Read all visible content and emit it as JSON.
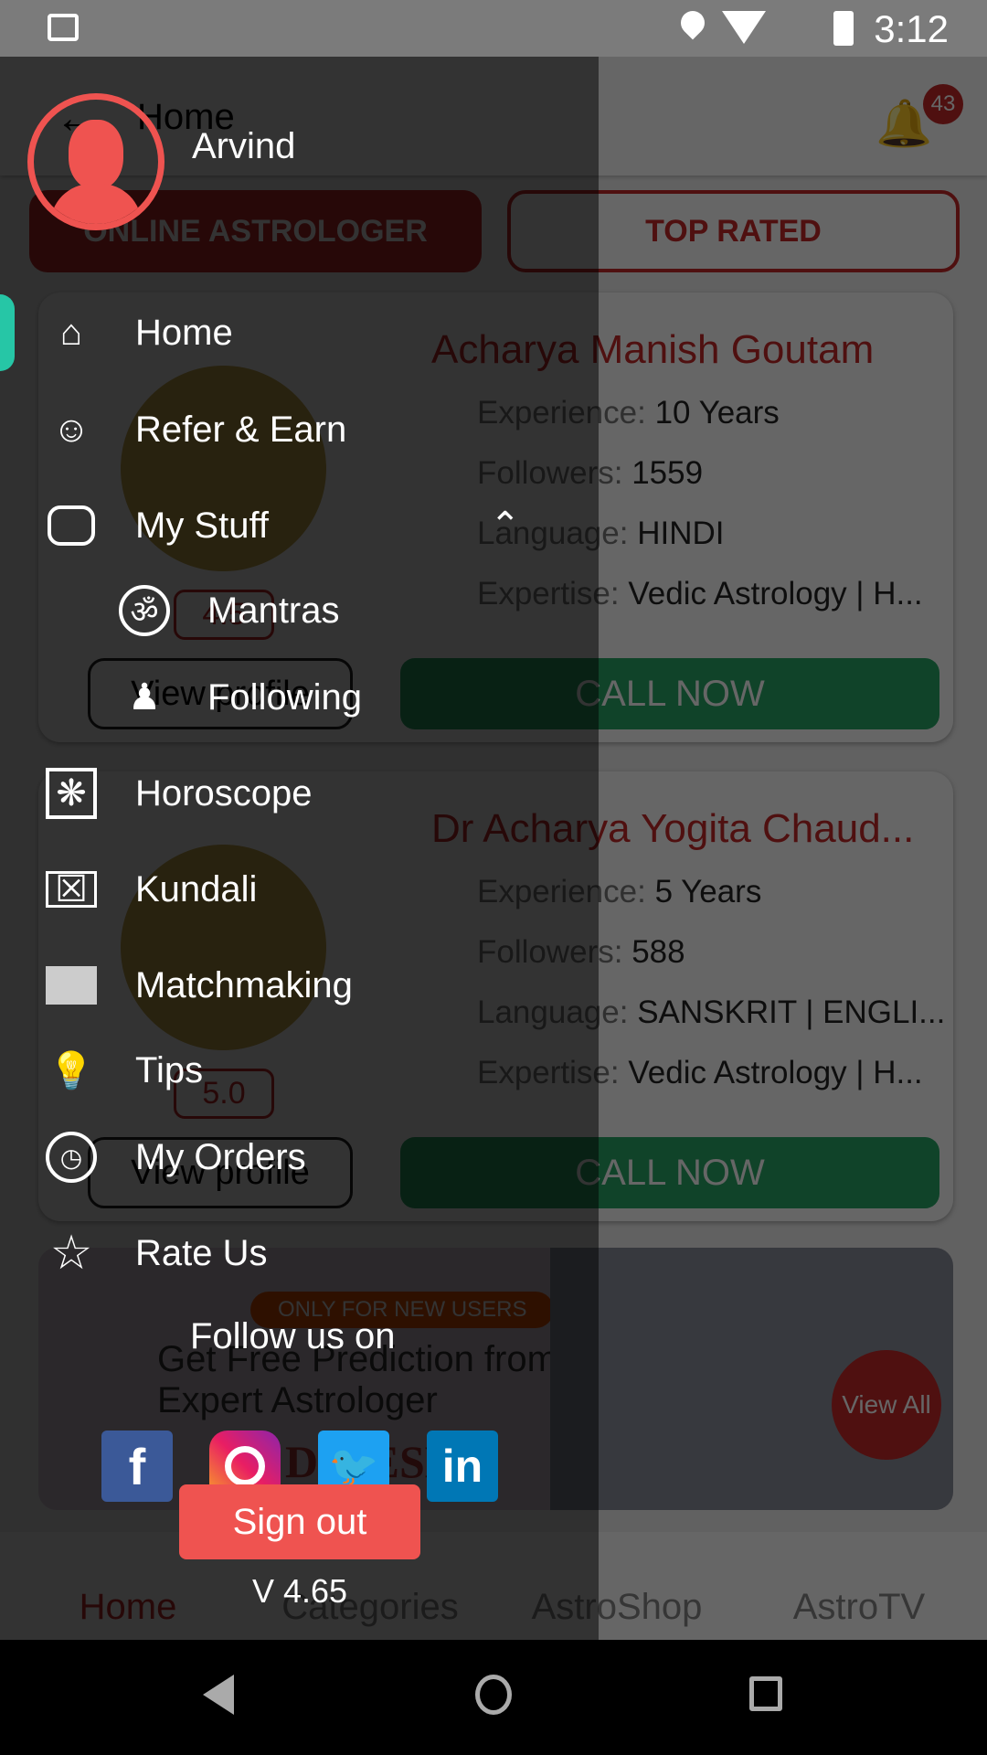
{
  "status_bar": {
    "time": "3:12"
  },
  "app": {
    "header": {
      "title": "Home",
      "notification_count": "43"
    },
    "tabs": [
      "ONLINE ASTROLOGER",
      "TOP RATED"
    ],
    "astrologers": [
      {
        "name": "Acharya Manish Goutam",
        "experience_label": "Experience:",
        "experience": "10 Years",
        "followers_label": "Followers:",
        "followers": "1559",
        "language_label": "Language:",
        "language": "HINDI",
        "expertise_label": "Expertise:",
        "expertise": "Vedic Astrology | H...",
        "rating": "4.5",
        "view_profile": "View profile",
        "call": "CALL NOW"
      },
      {
        "name": "Dr Acharya Yogita Chaud...",
        "experience_label": "Experience:",
        "experience": "5 Years",
        "followers_label": "Followers:",
        "followers": "588",
        "language_label": "Language:",
        "language": "SANSKRIT | ENGLI...",
        "expertise_label": "Expertise:",
        "expertise": "Vedic Astrology | H...",
        "rating": "5.0",
        "view_profile": "View profile",
        "call": "CALL NOW"
      }
    ],
    "banner": {
      "badge": "ONLY FOR NEW USERS",
      "headline": "Get Free Prediction from Our Expert Astrologer",
      "name": "DINESH",
      "view_all": "View All"
    },
    "bottom_nav": [
      "Home",
      "Categories",
      "AstroShop",
      "AstroTV"
    ]
  },
  "drawer": {
    "user_name": "Arvind",
    "items": [
      {
        "label": "Home",
        "icon": "home-icon"
      },
      {
        "label": "Refer & Earn",
        "icon": "refer-icon"
      },
      {
        "label": "My Stuff",
        "icon": "toggle-icon"
      },
      {
        "label": "Mantras",
        "icon": "om-icon"
      },
      {
        "label": "Following",
        "icon": "user-plus-icon"
      },
      {
        "label": "Horoscope",
        "icon": "horoscope-icon"
      },
      {
        "label": "Kundali",
        "icon": "kundali-icon"
      },
      {
        "label": "Matchmaking",
        "icon": "matchmaking-icon"
      },
      {
        "label": "Tips",
        "icon": "bulb-icon"
      },
      {
        "label": "My Orders",
        "icon": "history-icon"
      },
      {
        "label": "Rate Us",
        "icon": "star-icon"
      }
    ],
    "follow_label": "Follow us on",
    "social": [
      "facebook",
      "instagram",
      "twitter",
      "linkedin"
    ],
    "sign_out": "Sign out",
    "version": "V 4.65",
    "colors": {
      "accent": "#ef5350",
      "active_indicator": "#26c6a6"
    }
  }
}
